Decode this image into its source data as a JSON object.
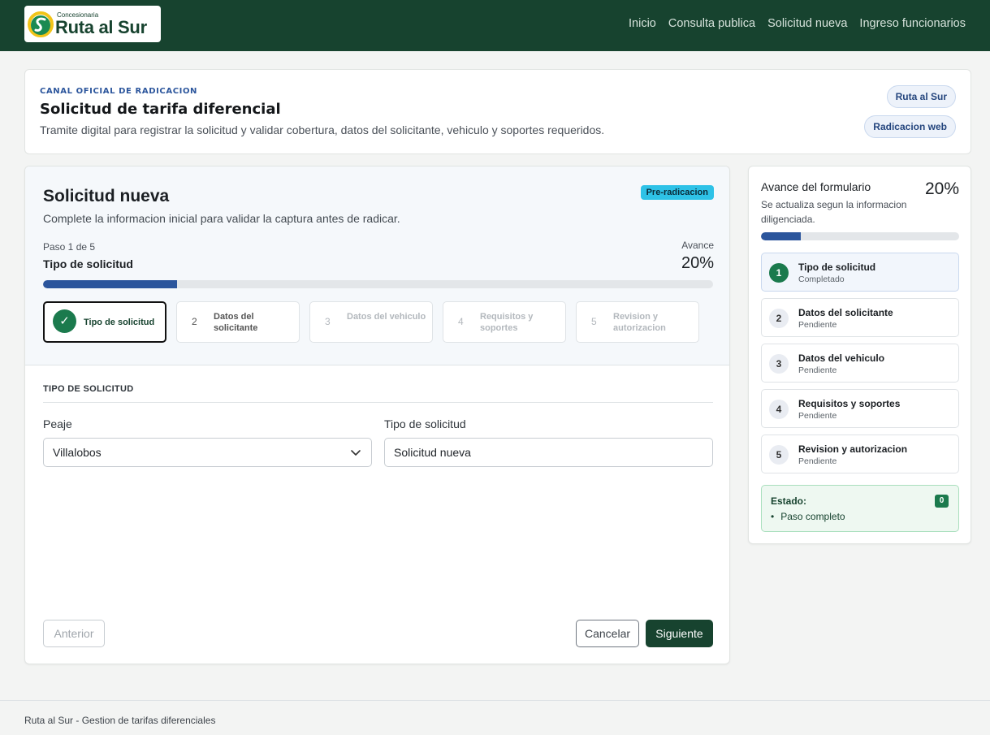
{
  "brand": {
    "small": "Concesionaria",
    "name": "Ruta al Sur",
    "logo_icon": "swirl-logo-icon"
  },
  "nav": [
    "Inicio",
    "Consulta publica",
    "Solicitud nueva",
    "Ingreso funcionarios"
  ],
  "intro": {
    "eyebrow": "CANAL OFICIAL DE RADICACION",
    "title": "Solicitud de tarifa diferencial",
    "desc": "Tramite digital para registrar la solicitud y validar cobertura, datos del solicitante, vehiculo y soportes requeridos.",
    "pills": [
      "Ruta al Sur",
      "Radicacion web"
    ]
  },
  "form": {
    "title": "Solicitud nueva",
    "subtitle": "Complete la informacion inicial para validar la captura antes de radicar.",
    "badge": "Pre-radicacion",
    "step_of": "Paso 1 de 5",
    "step_name": "Tipo de solicitud",
    "avance_label": "Avance",
    "avance_value": "20%",
    "progress": 0.2,
    "steps": [
      {
        "num": "1",
        "label": "Tipo de solicitud"
      },
      {
        "num": "2",
        "label": "Datos del solicitante"
      },
      {
        "num": "3",
        "label": "Datos del vehiculo"
      },
      {
        "num": "4",
        "label": "Requisitos y soportes"
      },
      {
        "num": "5",
        "label": "Revision y autorizacion"
      }
    ],
    "section_title": "TIPO DE SOLICITUD",
    "peaje_label": "Peaje",
    "peaje_value": "Villalobos",
    "tipo_label": "Tipo de solicitud",
    "tipo_value": "Solicitud nueva",
    "btn_prev": "Anterior",
    "btn_cancel": "Cancelar",
    "btn_next": "Siguiente"
  },
  "sidebar": {
    "title": "Avance del formulario",
    "desc": "Se actualiza segun la informacion diligenciada.",
    "pct": "20%",
    "progress": 0.2,
    "items": [
      {
        "num": "1",
        "name": "Tipo de solicitud",
        "state": "Completado"
      },
      {
        "num": "2",
        "name": "Datos del solicitante",
        "state": "Pendiente"
      },
      {
        "num": "3",
        "name": "Datos del vehiculo",
        "state": "Pendiente"
      },
      {
        "num": "4",
        "name": "Requisitos y soportes",
        "state": "Pendiente"
      },
      {
        "num": "5",
        "name": "Revision y autorizacion",
        "state": "Pendiente"
      }
    ],
    "estado_label": "Estado:",
    "estado_count": "0",
    "estado_item": "Paso completo"
  },
  "footer": "Ruta al Sur - Gestion de tarifas diferenciales",
  "colors": {
    "primary": "#17432f",
    "accent": "#2b559c",
    "success": "#1b7a4d",
    "badge": "#2ec2e7"
  }
}
